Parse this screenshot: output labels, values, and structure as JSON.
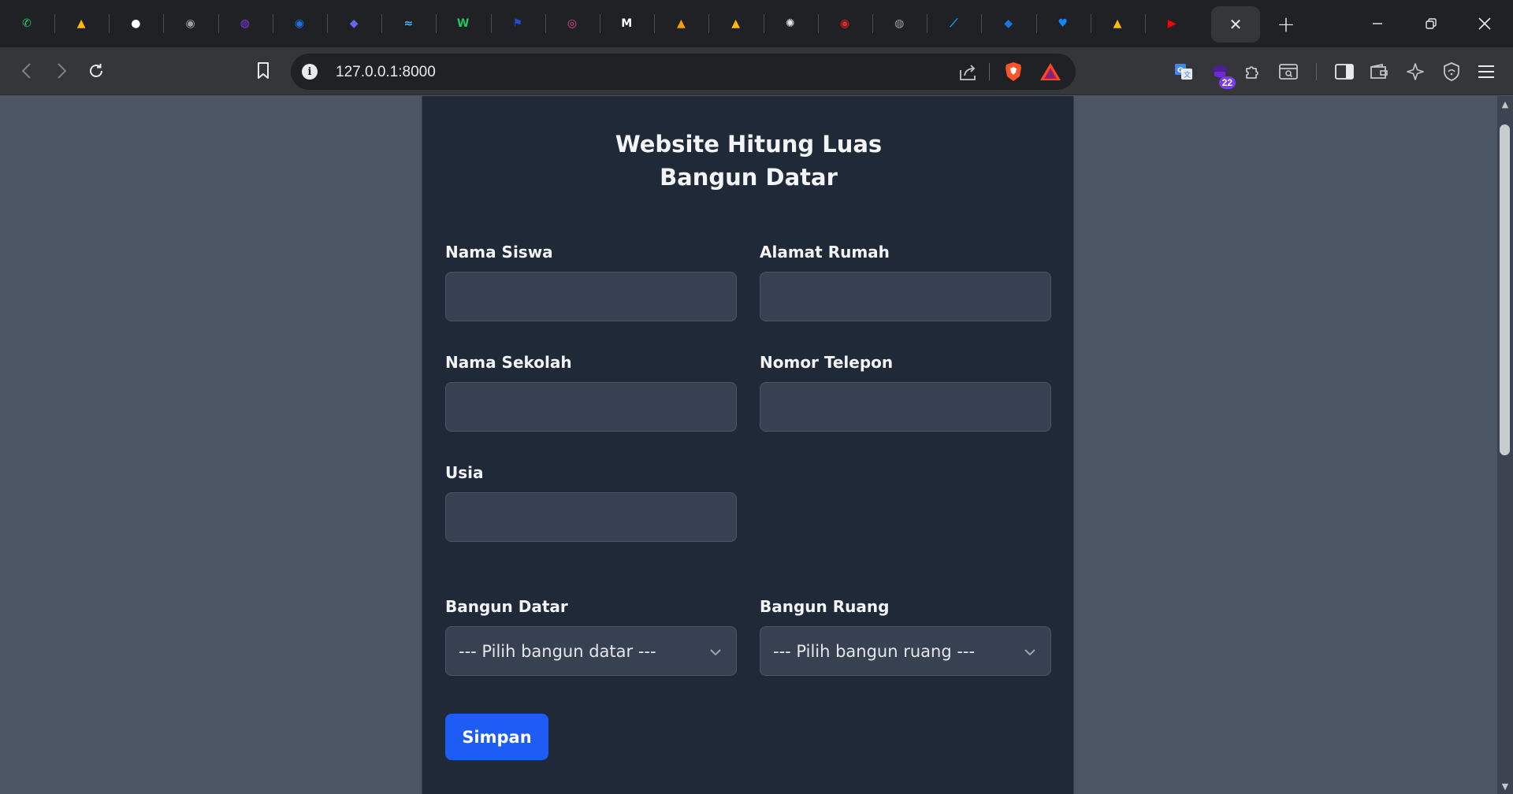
{
  "browser": {
    "pinned_tabs": [
      {
        "name": "whatsapp-icon",
        "color": "#25d366",
        "glyph": "✆"
      },
      {
        "name": "google-drive-icon",
        "color": "#fbbc04",
        "glyph": "▲"
      },
      {
        "name": "github-icon",
        "color": "#ffffff",
        "glyph": "●"
      },
      {
        "name": "app-icon",
        "color": "#9aa0a6",
        "glyph": "◉"
      },
      {
        "name": "app-icon",
        "color": "#7c3aed",
        "glyph": "◍"
      },
      {
        "name": "app-icon",
        "color": "#1a73e8",
        "glyph": "◉"
      },
      {
        "name": "app-icon",
        "color": "#6366f1",
        "glyph": "◆"
      },
      {
        "name": "tailwind-icon",
        "color": "#38bdf8",
        "glyph": "≈"
      },
      {
        "name": "app-icon",
        "color": "#22c55e",
        "glyph": "W"
      },
      {
        "name": "flag-icon",
        "color": "#1d4ed8",
        "glyph": "⚑"
      },
      {
        "name": "app-icon",
        "color": "#ec4899",
        "glyph": "◎"
      },
      {
        "name": "medium-icon",
        "color": "#ffffff",
        "glyph": "M"
      },
      {
        "name": "app-icon",
        "color": "#f59e0b",
        "glyph": "▲"
      },
      {
        "name": "google-drive-icon",
        "color": "#fbbc04",
        "glyph": "▲"
      },
      {
        "name": "openai-icon",
        "color": "#e8eaed",
        "glyph": "✺"
      },
      {
        "name": "app-icon",
        "color": "#dc2626",
        "glyph": "◉"
      },
      {
        "name": "globe-icon",
        "color": "#9aa0a6",
        "glyph": "◍"
      },
      {
        "name": "app-icon",
        "color": "#0ea5e9",
        "glyph": "⟋"
      },
      {
        "name": "app-icon",
        "color": "#1a73e8",
        "glyph": "◆"
      },
      {
        "name": "bluesky-icon",
        "color": "#1185fe",
        "glyph": "♥"
      },
      {
        "name": "google-drive-icon",
        "color": "#fbbc04",
        "glyph": "▲"
      },
      {
        "name": "youtube-icon",
        "color": "#ff0000",
        "glyph": "▶"
      }
    ],
    "url": "127.0.0.1:8000",
    "extension_badge": "22"
  },
  "page": {
    "title_line1": "Website Hitung Luas",
    "title_line2": "Bangun Datar",
    "fields": {
      "nama_siswa": {
        "label": "Nama Siswa",
        "value": ""
      },
      "alamat_rumah": {
        "label": "Alamat Rumah",
        "value": ""
      },
      "nama_sekolah": {
        "label": "Nama Sekolah",
        "value": ""
      },
      "nomor_telepon": {
        "label": "Nomor Telepon",
        "value": ""
      },
      "usia": {
        "label": "Usia",
        "value": ""
      }
    },
    "selects": {
      "bangun_datar": {
        "label": "Bangun Datar",
        "selected": "--- Pilih bangun datar ---"
      },
      "bangun_ruang": {
        "label": "Bangun Ruang",
        "selected": "--- Pilih bangun ruang ---"
      }
    },
    "submit_label": "Simpan"
  },
  "colors": {
    "page_bg": "#4b5563",
    "card_bg": "#1f2937",
    "input_bg": "#374151",
    "button": "#1d5cf5"
  }
}
